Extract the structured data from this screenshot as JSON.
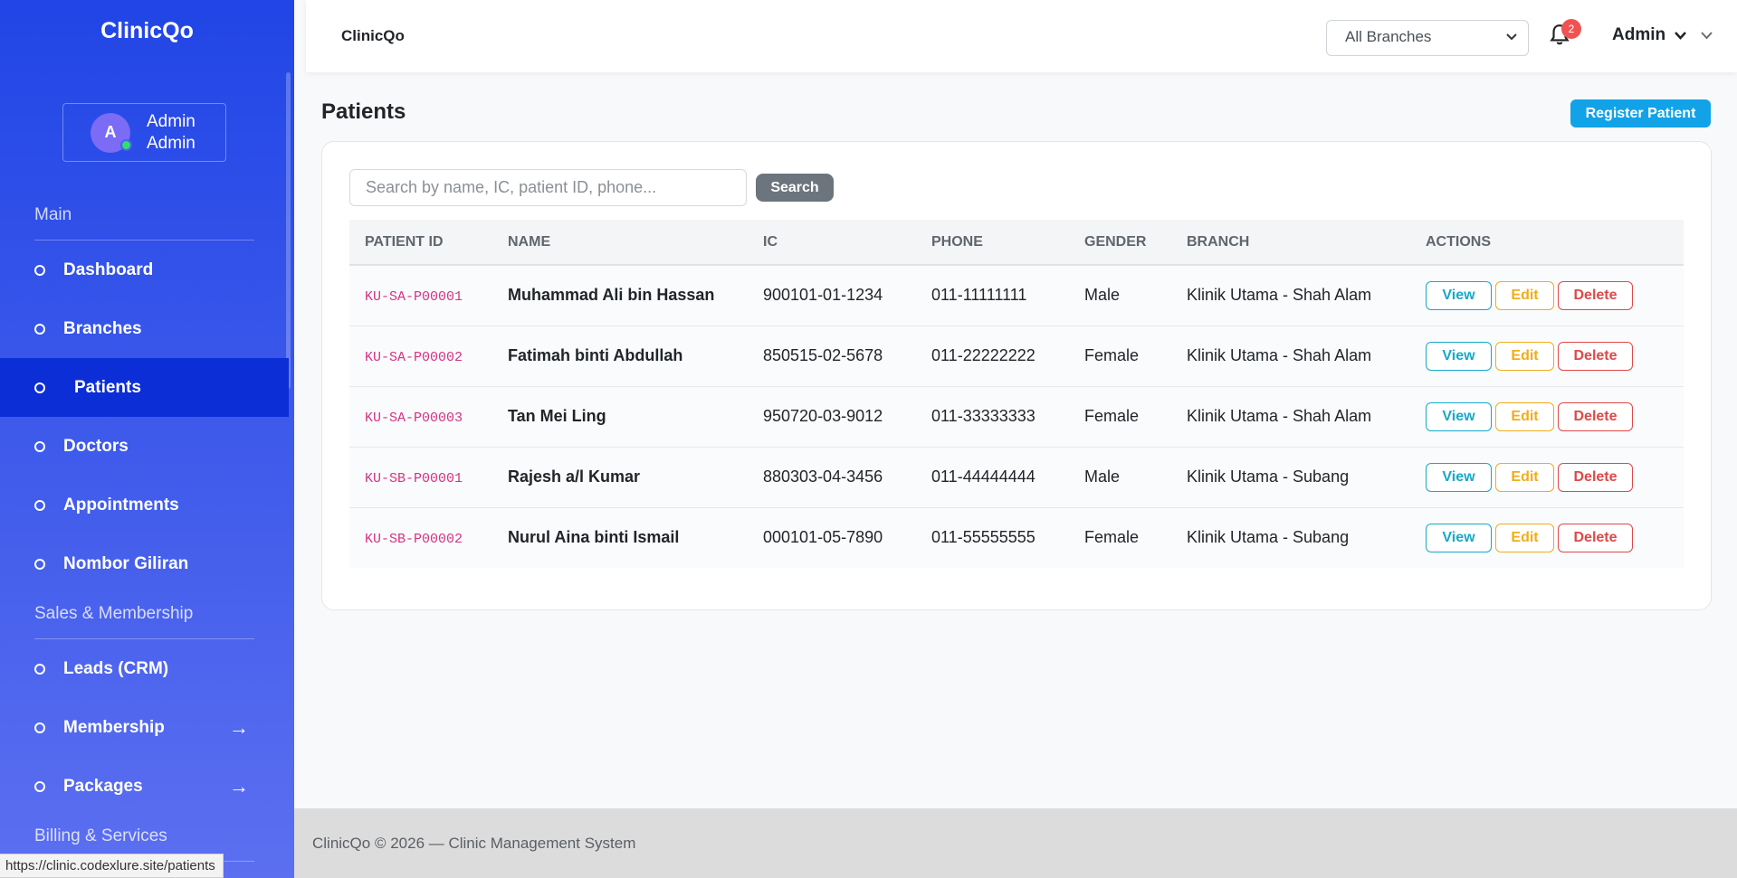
{
  "sidebar": {
    "brand": "ClinicQo",
    "user": {
      "initial": "A",
      "name": "Admin",
      "role": "Admin"
    },
    "sections": {
      "main": "Main",
      "sales": "Sales & Membership",
      "billing": "Billing & Services"
    },
    "items": [
      {
        "label": "Dashboard"
      },
      {
        "label": "Branches"
      },
      {
        "label": "Patients"
      },
      {
        "label": "Doctors"
      },
      {
        "label": "Appointments"
      },
      {
        "label": "Nombor Giliran"
      },
      {
        "label": "Leads (CRM)"
      },
      {
        "label": "Membership"
      },
      {
        "label": "Packages"
      }
    ]
  },
  "topbar": {
    "title": "ClinicQo",
    "branch_selected": "All Branches",
    "notifications": "2",
    "admin_label": "Admin"
  },
  "page": {
    "title": "Patients",
    "register_label": "Register Patient",
    "search_placeholder": "Search by name, IC, patient ID, phone...",
    "search_label": "Search"
  },
  "table": {
    "headers": [
      "PATIENT ID",
      "NAME",
      "IC",
      "PHONE",
      "GENDER",
      "BRANCH",
      "ACTIONS"
    ],
    "actions": {
      "view": "View",
      "edit": "Edit",
      "delete": "Delete"
    },
    "rows": [
      {
        "id": "KU-SA-P00001",
        "name": "Muhammad Ali bin Hassan",
        "ic": "900101-01-1234",
        "phone": "011-11111111",
        "gender": "Male",
        "branch": "Klinik Utama - Shah Alam"
      },
      {
        "id": "KU-SA-P00002",
        "name": "Fatimah binti Abdullah",
        "ic": "850515-02-5678",
        "phone": "011-22222222",
        "gender": "Female",
        "branch": "Klinik Utama - Shah Alam"
      },
      {
        "id": "KU-SA-P00003",
        "name": "Tan Mei Ling",
        "ic": "950720-03-9012",
        "phone": "011-33333333",
        "gender": "Female",
        "branch": "Klinik Utama - Shah Alam"
      },
      {
        "id": "KU-SB-P00001",
        "name": "Rajesh a/l Kumar",
        "ic": "880303-04-3456",
        "phone": "011-44444444",
        "gender": "Male",
        "branch": "Klinik Utama - Subang"
      },
      {
        "id": "KU-SB-P00002",
        "name": "Nurul Aina binti Ismail",
        "ic": "000101-05-7890",
        "phone": "011-55555555",
        "gender": "Female",
        "branch": "Klinik Utama - Subang"
      }
    ]
  },
  "footer": {
    "text": "ClinicQo © 2026 — Clinic Management System"
  },
  "status_url": "https://clinic.codexlure.site/patients",
  "colors": {
    "sidebar_top": "#2145e6",
    "sidebar_active": "#0c2ed6",
    "primary_button": "#12a2e8",
    "id_text": "#d63384",
    "view": "#17a9c7",
    "edit": "#f0ad1a",
    "delete": "#e04848"
  }
}
